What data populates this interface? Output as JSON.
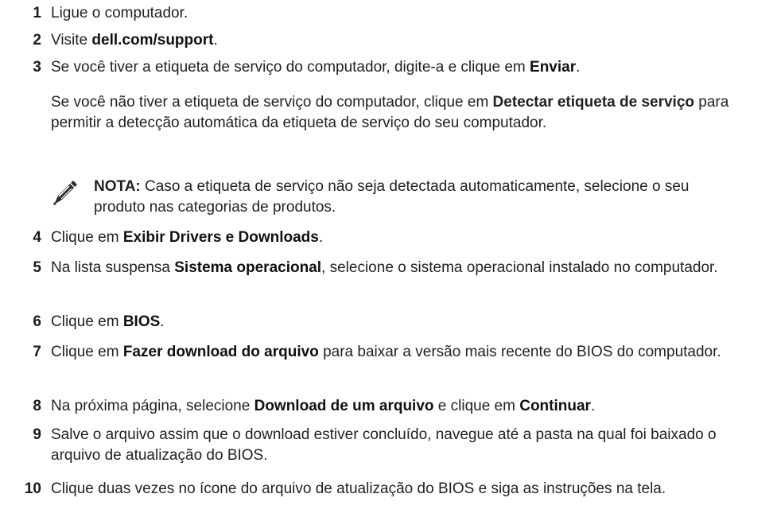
{
  "steps": [
    {
      "num": "1",
      "parts": [
        {
          "t": "Ligue o computador.",
          "b": false
        }
      ]
    },
    {
      "num": "2",
      "parts": [
        {
          "t": "Visite ",
          "b": false
        },
        {
          "t": "dell.com/support",
          "b": true
        },
        {
          "t": ".",
          "b": false
        }
      ]
    },
    {
      "num": "3",
      "parts": [
        {
          "t": "Se você tiver a etiqueta de serviço do computador, digite-a e clique em ",
          "b": false
        },
        {
          "t": "Enviar",
          "b": true
        },
        {
          "t": ".",
          "b": false
        }
      ]
    },
    {
      "num": "4",
      "parts": [
        {
          "t": "Clique em ",
          "b": false
        },
        {
          "t": "Exibir Drivers e Downloads",
          "b": true
        },
        {
          "t": ".",
          "b": false
        }
      ]
    },
    {
      "num": "5",
      "parts": [
        {
          "t": "Na lista suspensa ",
          "b": false
        },
        {
          "t": "Sistema operacional",
          "b": true
        },
        {
          "t": ", selecione o sistema operacional instalado no computador.",
          "b": false
        }
      ]
    },
    {
      "num": "6",
      "parts": [
        {
          "t": "Clique em ",
          "b": false
        },
        {
          "t": "BIOS",
          "b": true
        },
        {
          "t": ".",
          "b": false
        }
      ]
    },
    {
      "num": "7",
      "parts": [
        {
          "t": "Clique em ",
          "b": false
        },
        {
          "t": "Fazer download do arquivo",
          "b": true
        },
        {
          "t": " para baixar a versão mais recente do BIOS do computador.",
          "b": false
        }
      ]
    },
    {
      "num": "8",
      "parts": [
        {
          "t": "Na próxima página, selecione ",
          "b": false
        },
        {
          "t": "Download de um arquivo",
          "b": true
        },
        {
          "t": " e clique em ",
          "b": false
        },
        {
          "t": "Continuar",
          "b": true
        },
        {
          "t": ".",
          "b": false
        }
      ]
    },
    {
      "num": "9",
      "parts": [
        {
          "t": "Salve o arquivo assim que o download estiver concluído, navegue até a pasta na qual foi baixado o arquivo de atualização do BIOS.",
          "b": false
        }
      ]
    },
    {
      "num": "10",
      "parts": [
        {
          "t": "Clique duas vezes no ícone do arquivo de atualização do BIOS e siga as instruções na tela.",
          "b": false
        }
      ]
    }
  ],
  "step3_extra": {
    "parts": [
      {
        "t": "Se você não tiver a etiqueta de serviço do computador, clique em ",
        "b": false
      },
      {
        "t": "Detectar etiqueta de serviço",
        "b": true
      },
      {
        "t": " para permitir a detecção automática da etiqueta de serviço do seu computador.",
        "b": false
      }
    ]
  },
  "note": {
    "label": "NOTA:",
    "text": " Caso a etiqueta de serviço não seja detectada automaticamente, selecione o seu produto nas categorias de produtos.",
    "icon": "pencil-note-icon"
  }
}
